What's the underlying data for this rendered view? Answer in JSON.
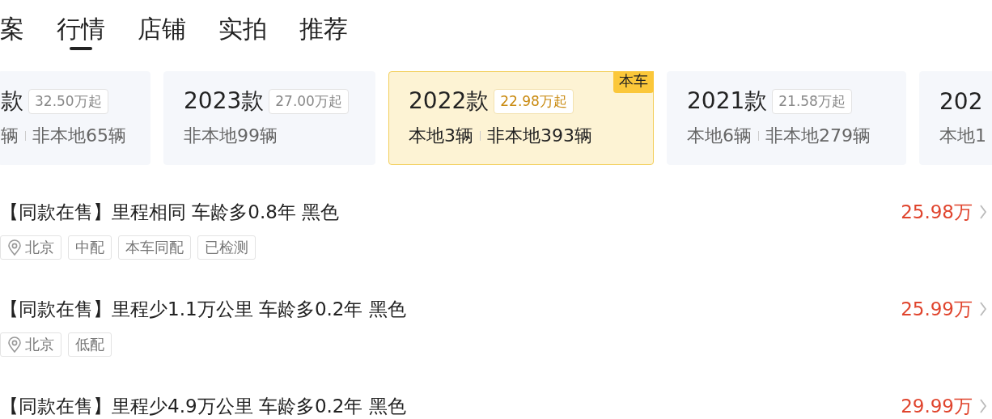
{
  "tabs": [
    {
      "label": "案",
      "selected": false
    },
    {
      "label": "行情",
      "selected": true
    },
    {
      "label": "店铺",
      "selected": false
    },
    {
      "label": "实拍",
      "selected": false
    },
    {
      "label": "推荐",
      "selected": false
    }
  ],
  "model_years": [
    {
      "year": "款",
      "price": "32.50万起",
      "local": "辆",
      "nonlocal": "非本地65辆",
      "selected": false
    },
    {
      "year": "2023款",
      "price": "27.00万起",
      "nonlocal": "非本地99辆",
      "selected": false
    },
    {
      "year": "2022款",
      "price": "22.98万起",
      "local": "本地3辆",
      "nonlocal": "非本地393辆",
      "selected": true,
      "badge": "本车"
    },
    {
      "year": "2021款",
      "price": "21.58万起",
      "local": "本地6辆",
      "nonlocal": "非本地279辆",
      "selected": false
    },
    {
      "year": "202",
      "local": "本地1",
      "selected": false
    }
  ],
  "listings": [
    {
      "title": "【同款在售】里程相同 车龄多0.8年 黑色",
      "price": "25.98万",
      "tags": [
        {
          "kind": "location",
          "label": "北京"
        },
        {
          "kind": "plain",
          "label": "中配"
        },
        {
          "kind": "plain",
          "label": "本车同配"
        },
        {
          "kind": "plain",
          "label": "已检测"
        }
      ]
    },
    {
      "title": "【同款在售】里程少1.1万公里 车龄多0.2年 黑色",
      "price": "25.99万",
      "tags": [
        {
          "kind": "location",
          "label": "北京"
        },
        {
          "kind": "plain",
          "label": "低配"
        }
      ]
    },
    {
      "title": "【同款在售】里程少4.9万公里 车龄多0.2年 黑色",
      "price": "29.99万"
    }
  ]
}
